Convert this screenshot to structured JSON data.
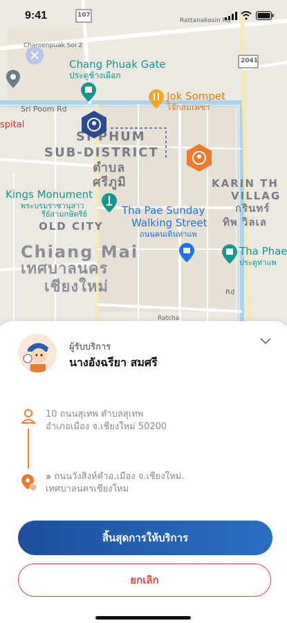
{
  "status_bar": {
    "time": "9:41"
  },
  "map": {
    "roads": {
      "route_107": "107",
      "rattanakosin_rd": "Rattanakosin Rd",
      "chareonpuak_soi": "Charoenpuak Soi 2",
      "route_2041": "2041",
      "sri_poom_rd": "Sri Poom Rd",
      "rd": "Rd",
      "ratcha": "Ratcha"
    },
    "places": {
      "chang_phuak_gate_en": "Chang Phuak Gate",
      "chang_phuak_gate_th": "ประตูช้างเผือก",
      "jok_sompet_en": "Jok Sompet",
      "jok_sompet_th": "โจ๊กสมเพชร",
      "hospital": "spital",
      "sriphum_1": "SI PHUM",
      "sriphum_2": "SUB-DISTRICT",
      "sriphum_th_1": "ตำบล",
      "sriphum_th_2": "ศรีภูมิ",
      "kings_monument_en": "Kings Monument",
      "kings_monument_th_1": "พระบรมราชานุสาว",
      "kings_monument_th_2": "รีย์สามกษัตริย์",
      "old_city": "OLD CITY",
      "tha_pae_sunday_1": "Tha Pae Sunday",
      "tha_pae_sunday_2": "Walking Street",
      "tha_pae_sunday_th": "ถนนคนเดินท่าแพ",
      "karin_1": "KARIN TH",
      "karin_2": "VILLAG",
      "karin_th_1": "กรินทร์",
      "karin_th_2": "ทิพ วิลเล",
      "chiang_mai_en": "Chiang Mai",
      "chiang_mai_th_1": "เทศบาลนคร",
      "chiang_mai_th_2": "เชียงใหม่",
      "tha_phae_en": "Tha Phae",
      "tha_phae_th": "ประตูท่าแพ"
    }
  },
  "sheet": {
    "role_label": "ผู้รับบริการ",
    "customer_name": "นางอังฉรียา สมศรี",
    "pickup_line_1": "10 ถนนสุเทพ ตำบลสุเทพ",
    "pickup_line_2": "อำเภอเมือง จ.เชียงใหม่ 50200",
    "dropoff_line_1": "๑ ถนนวังสิงห์คำอ.เมือง จ.เชียงใหม่.",
    "dropoff_line_2": "เทศบาลนครเชียงใหม",
    "finish_button": "สิ้นสุดการให้บริการ",
    "cancel_button": "ยกเลิก"
  },
  "colors": {
    "primary": "#1d4f9c",
    "cancel": "#e0453a",
    "marker_blue": "#2b4a8f",
    "marker_orange": "#f07a2b",
    "accent_orange": "#f07a2b"
  },
  "icons": [
    "signal-icon",
    "wifi-icon",
    "battery-icon",
    "person-icon",
    "location-pin-icon",
    "chevron-down-icon",
    "close-icon",
    "fork-knife-icon",
    "shopping-icon"
  ]
}
